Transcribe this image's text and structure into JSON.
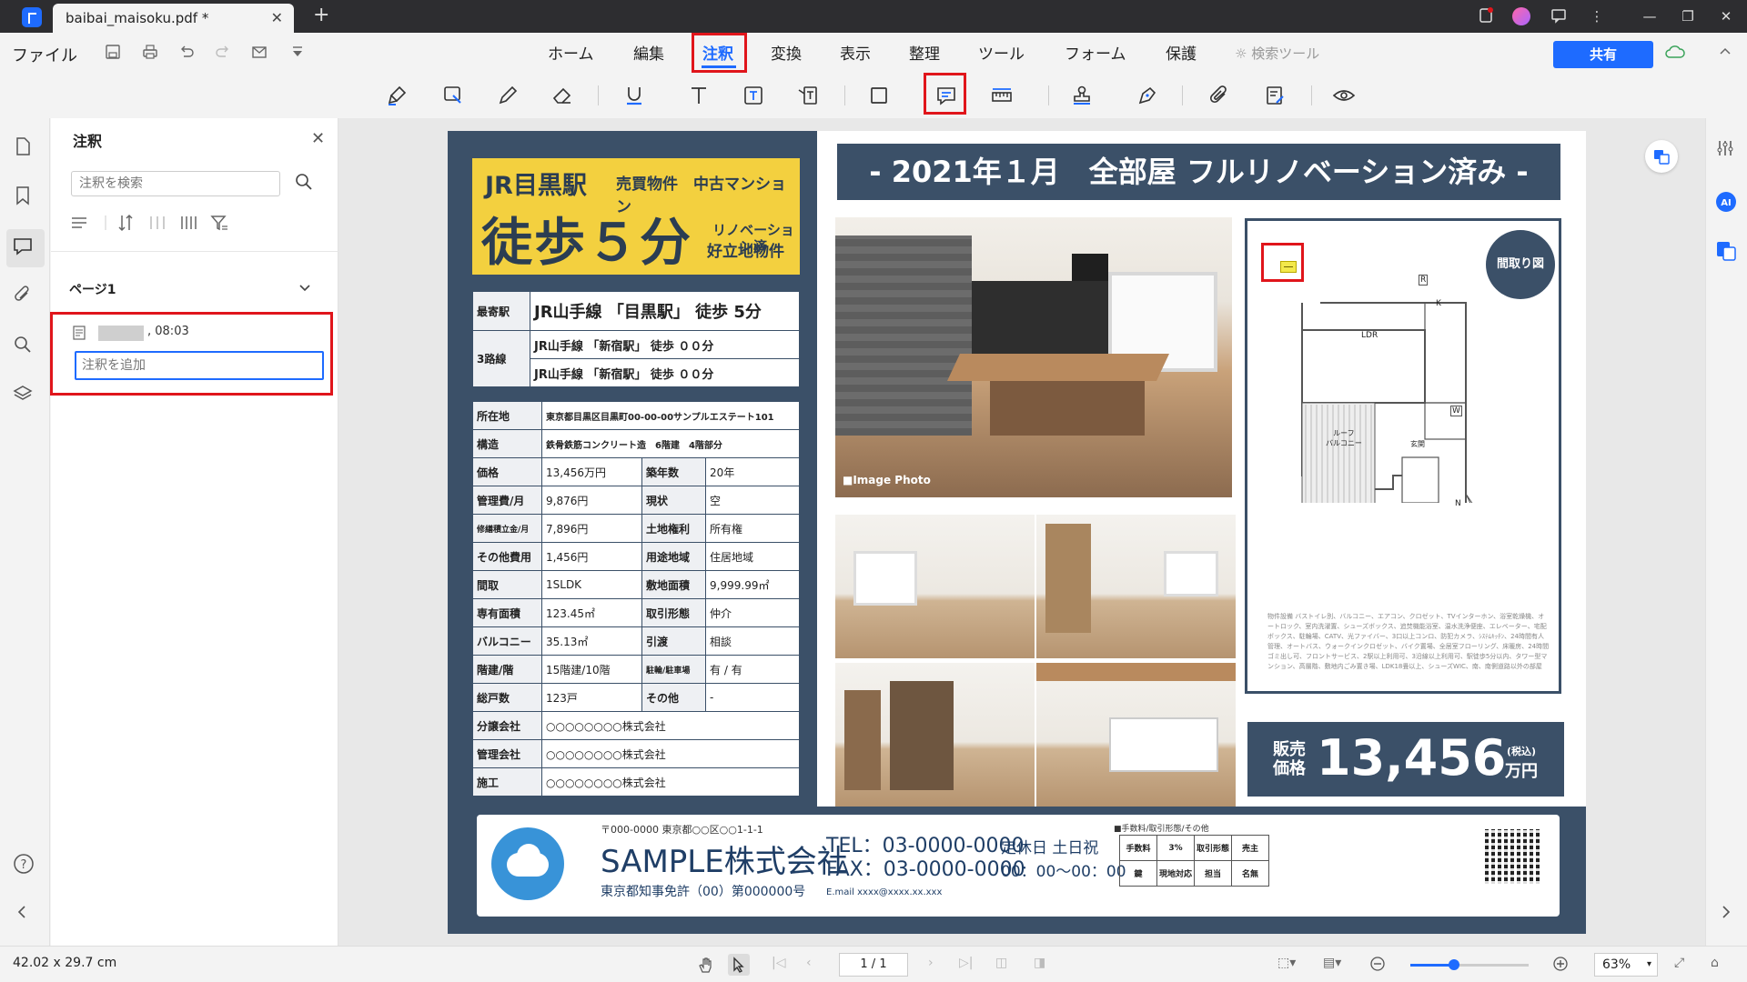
{
  "titlebar": {
    "tab_title": "baibai_maisoku.pdf *",
    "tab_close": "✕",
    "new_tab": "+"
  },
  "menubar": {
    "file": "ファイル",
    "nav": [
      "ホーム",
      "編集",
      "注釈",
      "変換",
      "表示",
      "整理",
      "ツール",
      "フォーム",
      "保護"
    ],
    "active": "注釈",
    "search_tool": "検索ツール",
    "share": "共有"
  },
  "annotation_toolbar": {
    "tools": [
      "highlight",
      "area-highlight",
      "pencil",
      "eraser",
      "underline",
      "text",
      "text-box",
      "text-callout",
      "rectangle",
      "note",
      "measure",
      "stamp",
      "signature",
      "attachment",
      "form",
      "hide-annotations"
    ],
    "selected": "note"
  },
  "panel": {
    "title": "注釈",
    "search_placeholder": "注釈を検索",
    "page_label": "ページ1",
    "comment": {
      "time": "08:03",
      "input_placeholder": "注釈を追加"
    }
  },
  "document": {
    "banner": {
      "station": "JR目黒駅",
      "tags": "売買物件　中古マンション",
      "walk": "徒歩５分",
      "sub1": "リノベーション済",
      "sub2": "好立地物件"
    },
    "station_table": {
      "nearest_label": "最寄駅",
      "nearest_value": "JR山手線 「目黒駅」 徒歩 5分",
      "lines_label": "3路線",
      "line1": "JR山手線 「新宿駅」 徒歩 ００分",
      "line2": "JR山手線 「新宿駅」 徒歩 ００分"
    },
    "address": {
      "label": "所在地",
      "value": "東京都目黒区目黒町00-00-00サンプルエステート101"
    },
    "structure": {
      "label": "構造",
      "value": "鉄骨鉄筋コンクリート造　6階建　4階部分"
    },
    "spec_rows": [
      [
        "価格",
        "13,456万円",
        "築年数",
        "20年"
      ],
      [
        "管理費/月",
        "9,876円",
        "現状",
        "空"
      ],
      [
        "修繕積立金/月",
        "7,896円",
        "土地権利",
        "所有権"
      ],
      [
        "その他費用",
        "1,456円",
        "用途地域",
        "住居地域"
      ],
      [
        "間取",
        "1SLDK",
        "敷地面積",
        "9,999.99㎡"
      ],
      [
        "専有面積",
        "123.45㎡",
        "取引形態",
        "仲介"
      ],
      [
        "バルコニー",
        "35.13㎡",
        "引渡",
        "相談"
      ],
      [
        "階建/階",
        "15階建/10階",
        "駐輪/駐車場",
        "有 / 有"
      ],
      [
        "総戸数",
        "123戸",
        "その他",
        "-"
      ]
    ],
    "company_rows": [
      [
        "分譲会社",
        "○○○○○○○○株式会社"
      ],
      [
        "管理会社",
        "○○○○○○○○株式会社"
      ],
      [
        "施工",
        "○○○○○○○○株式会社"
      ]
    ],
    "headline": "- 2021年１月　全部屋 フルリノベーション済み -",
    "photo_caption": "■Image Photo",
    "floorplan": {
      "badge": "間取り図",
      "ldr": "LDR",
      "roof_balcony": "ルーフ\nバルコニー",
      "entrance": "玄関",
      "k": "K",
      "r": "R",
      "w": "W",
      "n": "N",
      "notes": "物件設備\nバストイレ別、バルコニー、エアコン、クロゼット、TVインターホン、浴室乾燥機、オートロック、室内洗濯置、シューズボックス、追焚機能浴室、温水洗浄便座、エレベーター、宅配ボックス、駐輪場、CATV、光ファイバー、3口以上コンロ、防犯カメラ、ｼｽﾃﾑｷｯﾁﾝ、24時間有人管理、オートバス、ウォークインクロゼット、バイク置場、全居室フローリング、床暖房、24時間ゴミ出し可、フロントサービス、2駅以上利用可、3沿線以上利用可、駅徒歩5分以内、タワー型マンション、高層階、敷地内ごみ置き場、LDK18畳以上、シューズWIC、南、南側道路以外の部屋"
    },
    "price": {
      "label": "販売\n価格",
      "value": "13,456",
      "tax": "(税込)",
      "unit": "万円"
    },
    "footer": {
      "address": "〒000-0000 東京都○○区○○1-1-1",
      "company": "SAMPLE株式会社",
      "license": "東京都知事免許（00）第000000号",
      "tel": "TEL：03-0000-0000",
      "fax": "FAX：03-0000-0000",
      "email": "E.mail xxxx@xxxx.xx.xxx",
      "holiday": "定休日 土日祝",
      "hours": "00：00〜00：00",
      "fee_title": "■手数料/取引形態/その他",
      "fee_rows": [
        [
          "手数料",
          "3%",
          "取引形態",
          "売主"
        ],
        [
          "鍵",
          "現地対応",
          "担当",
          "名無"
        ]
      ]
    }
  },
  "statusbar": {
    "paper_size": "42.02 x 29.7 cm",
    "page": "1 / 1",
    "zoom": "63%"
  },
  "colors": {
    "accent": "#1e6bff",
    "highlight_box": "#e0151b",
    "doc_navy": "#3b5068",
    "banner_yellow": "#f3d03f"
  }
}
